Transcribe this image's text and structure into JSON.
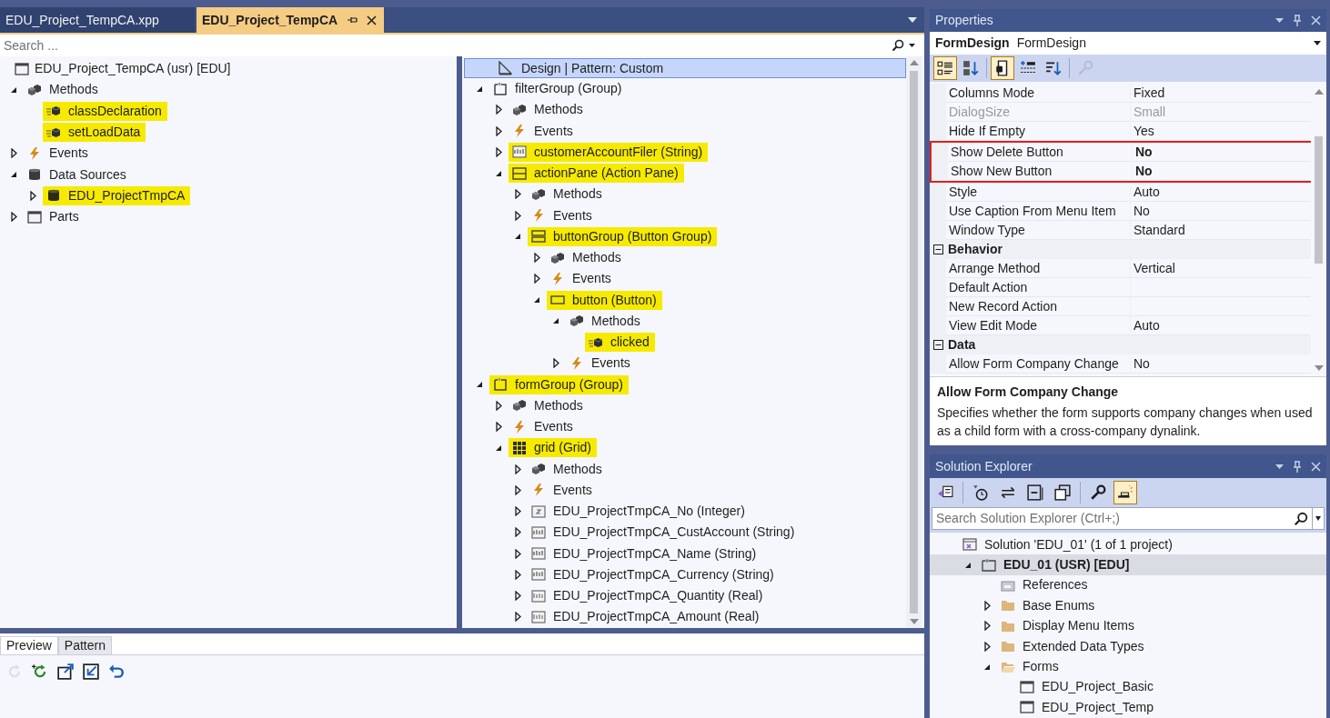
{
  "editor_tabs": [
    {
      "label": "EDU_Project_TempCA.xpp",
      "selected": false
    },
    {
      "label": "EDU_Project_TempCA",
      "selected": true
    }
  ],
  "search": {
    "placeholder": "Search ..."
  },
  "element_tree": {
    "root": {
      "label": "EDU_Project_TempCA (usr) [EDU]",
      "kind": "form"
    },
    "children": [
      {
        "label": "Methods",
        "kind": "methods",
        "expanded": true,
        "highlighted": false,
        "children": [
          {
            "label": "classDeclaration",
            "kind": "method",
            "highlighted": true
          },
          {
            "label": "setLoadData",
            "kind": "method",
            "highlighted": true
          }
        ]
      },
      {
        "label": "Events",
        "kind": "events",
        "expanded": false,
        "highlighted": false
      },
      {
        "label": "Data Sources",
        "kind": "datasource",
        "expanded": true,
        "highlighted": false,
        "children": [
          {
            "label": "EDU_ProjectTmpCA",
            "kind": "table",
            "expanded": false,
            "highlighted": true
          }
        ]
      },
      {
        "label": "Parts",
        "kind": "form",
        "expanded": false,
        "highlighted": false
      }
    ]
  },
  "design_tree": {
    "root": {
      "label": "Design | Pattern: Custom",
      "kind": "design",
      "selected": true
    },
    "children": [
      {
        "label": "filterGroup (Group)",
        "kind": "group",
        "expanded": true,
        "highlighted": false,
        "children": [
          {
            "label": "Methods",
            "kind": "methods",
            "expanded": false,
            "highlighted": false
          },
          {
            "label": "Events",
            "kind": "events",
            "expanded": false,
            "highlighted": false
          },
          {
            "label": "customerAccountFiler (String)",
            "kind": "string",
            "expanded": false,
            "highlighted": true
          },
          {
            "label": "actionPane (Action Pane)",
            "kind": "actionpane",
            "expanded": true,
            "highlighted": true,
            "children": [
              {
                "label": "Methods",
                "kind": "methods",
                "expanded": false,
                "highlighted": false
              },
              {
                "label": "Events",
                "kind": "events",
                "expanded": false,
                "highlighted": false
              },
              {
                "label": "buttonGroup (Button Group)",
                "kind": "buttongroup",
                "expanded": true,
                "highlighted": true,
                "children": [
                  {
                    "label": "Methods",
                    "kind": "methods",
                    "expanded": false,
                    "highlighted": false
                  },
                  {
                    "label": "Events",
                    "kind": "events",
                    "expanded": false,
                    "highlighted": false
                  },
                  {
                    "label": "button (Button)",
                    "kind": "button",
                    "expanded": true,
                    "highlighted": true,
                    "children": [
                      {
                        "label": "Methods",
                        "kind": "methods",
                        "expanded": true,
                        "highlighted": false,
                        "children": [
                          {
                            "label": "clicked",
                            "kind": "method",
                            "highlighted": true
                          }
                        ]
                      },
                      {
                        "label": "Events",
                        "kind": "events",
                        "expanded": false,
                        "highlighted": false
                      }
                    ]
                  }
                ]
              }
            ]
          }
        ]
      },
      {
        "label": "formGroup (Group)",
        "kind": "group",
        "expanded": true,
        "highlighted": true,
        "children": [
          {
            "label": "Methods",
            "kind": "methods",
            "expanded": false,
            "highlighted": false
          },
          {
            "label": "Events",
            "kind": "events",
            "expanded": false,
            "highlighted": false
          },
          {
            "label": "grid (Grid)",
            "kind": "grid",
            "expanded": true,
            "highlighted": true,
            "children": [
              {
                "label": "Methods",
                "kind": "methods",
                "expanded": false,
                "highlighted": false
              },
              {
                "label": "Events",
                "kind": "events",
                "expanded": false,
                "highlighted": false
              },
              {
                "label": "EDU_ProjectTmpCA_No (Integer)",
                "kind": "integer",
                "expanded": false,
                "highlighted": false
              },
              {
                "label": "EDU_ProjectTmpCA_CustAccount (String)",
                "kind": "string",
                "expanded": false,
                "highlighted": false
              },
              {
                "label": "EDU_ProjectTmpCA_Name (String)",
                "kind": "string",
                "expanded": false,
                "highlighted": false
              },
              {
                "label": "EDU_ProjectTmpCA_Currency (String)",
                "kind": "string",
                "expanded": false,
                "highlighted": false
              },
              {
                "label": "EDU_ProjectTmpCA_Quantity (Real)",
                "kind": "real",
                "expanded": false,
                "highlighted": false
              },
              {
                "label": "EDU_ProjectTmpCA_Amount (Real)",
                "kind": "real",
                "expanded": false,
                "highlighted": false
              }
            ]
          }
        ]
      }
    ]
  },
  "bottom_panel": {
    "tabs": [
      {
        "label": "Preview",
        "selected": true
      },
      {
        "label": "Pattern",
        "selected": false
      }
    ],
    "toolbar": [
      {
        "kind": "refresh",
        "disabled": true
      },
      {
        "kind": "refresh-green",
        "disabled": false
      },
      {
        "kind": "export",
        "disabled": false
      },
      {
        "kind": "import",
        "disabled": false
      },
      {
        "kind": "undo",
        "disabled": false
      }
    ]
  },
  "properties": {
    "title": "Properties",
    "object_name": "FormDesign",
    "object_type": "FormDesign",
    "toolbar": [
      {
        "kind": "categorized",
        "selected": true,
        "disabled": false
      },
      {
        "kind": "alphabetical",
        "selected": false,
        "disabled": false
      },
      {
        "kind": "property-pages",
        "selected": true,
        "disabled": false
      },
      {
        "kind": "events",
        "selected": false,
        "disabled": false
      },
      {
        "kind": "sort",
        "selected": false,
        "disabled": false
      },
      {
        "kind": "wrench",
        "selected": false,
        "disabled": true
      }
    ],
    "rows": [
      {
        "kind": "property",
        "name": "Columns Mode",
        "value": "Fixed",
        "disabled": false,
        "modified": false,
        "outlined": false
      },
      {
        "kind": "property",
        "name": "DialogSize",
        "value": "Small",
        "disabled": true,
        "modified": false,
        "outlined": false
      },
      {
        "kind": "property",
        "name": "Hide If Empty",
        "value": "Yes",
        "disabled": false,
        "modified": false,
        "outlined": false
      },
      {
        "kind": "property",
        "name": "Show Delete Button",
        "value": "No",
        "disabled": false,
        "modified": true,
        "outlined": true
      },
      {
        "kind": "property",
        "name": "Show New Button",
        "value": "No",
        "disabled": false,
        "modified": true,
        "outlined": true
      },
      {
        "kind": "property",
        "name": "Style",
        "value": "Auto",
        "disabled": false,
        "modified": false,
        "outlined": false
      },
      {
        "kind": "property",
        "name": "Use Caption From Menu Item",
        "value": "No",
        "disabled": false,
        "modified": false,
        "outlined": false
      },
      {
        "kind": "property",
        "name": "Window Type",
        "value": "Standard",
        "disabled": false,
        "modified": false,
        "outlined": false
      },
      {
        "kind": "category",
        "name": "Behavior",
        "expanded": true
      },
      {
        "kind": "property",
        "name": "Arrange Method",
        "value": "Vertical",
        "disabled": false,
        "modified": false,
        "outlined": false
      },
      {
        "kind": "property",
        "name": "Default Action",
        "disabled": false,
        "outlined": false
      },
      {
        "kind": "property",
        "name": "New Record Action",
        "disabled": false,
        "outlined": false
      },
      {
        "kind": "property",
        "name": "View Edit Mode",
        "value": "Auto",
        "disabled": false,
        "modified": false,
        "outlined": false
      },
      {
        "kind": "category",
        "name": "Data",
        "expanded": true
      },
      {
        "kind": "property",
        "name": "Allow Form Company Change",
        "value": "No",
        "disabled": false,
        "modified": false,
        "outlined": false
      }
    ],
    "description_title": "Allow Form Company Change",
    "description": "Specifies whether the form supports company changes when used as a child form with a cross-company dynalink."
  },
  "solution_explorer": {
    "title": "Solution Explorer",
    "toolbar": [
      {
        "kind": "home",
        "selected": false
      },
      {
        "kind": "history",
        "selected": false
      },
      {
        "kind": "sync",
        "selected": false
      },
      {
        "kind": "collapse",
        "selected": false
      },
      {
        "kind": "copy",
        "selected": false
      },
      {
        "kind": "wrench",
        "selected": false
      },
      {
        "kind": "preview",
        "selected": true
      }
    ],
    "search": {
      "placeholder": "Search Solution Explorer (Ctrl+;)"
    },
    "tree": [
      {
        "label": "Solution 'EDU_01' (1 of 1 project)",
        "kind": "solution",
        "selected": false,
        "children": [
          {
            "label": "EDU_01 (USR) [EDU]",
            "kind": "project",
            "expanded": true,
            "selected": true,
            "children": [
              {
                "label": "References",
                "kind": "references",
                "selected": false
              },
              {
                "label": "Base Enums",
                "kind": "folder",
                "expanded": false,
                "selected": false
              },
              {
                "label": "Display Menu Items",
                "kind": "folder",
                "expanded": false,
                "selected": false
              },
              {
                "label": "Extended Data Types",
                "kind": "folder",
                "expanded": false,
                "selected": false
              },
              {
                "label": "Forms",
                "kind": "folder",
                "expanded": true,
                "selected": false,
                "children": [
                  {
                    "label": "EDU_Project_Basic",
                    "kind": "form",
                    "selected": false
                  },
                  {
                    "label": "EDU_Project_Temp",
                    "kind": "form",
                    "selected": false
                  }
                ]
              }
            ]
          }
        ]
      }
    ]
  }
}
